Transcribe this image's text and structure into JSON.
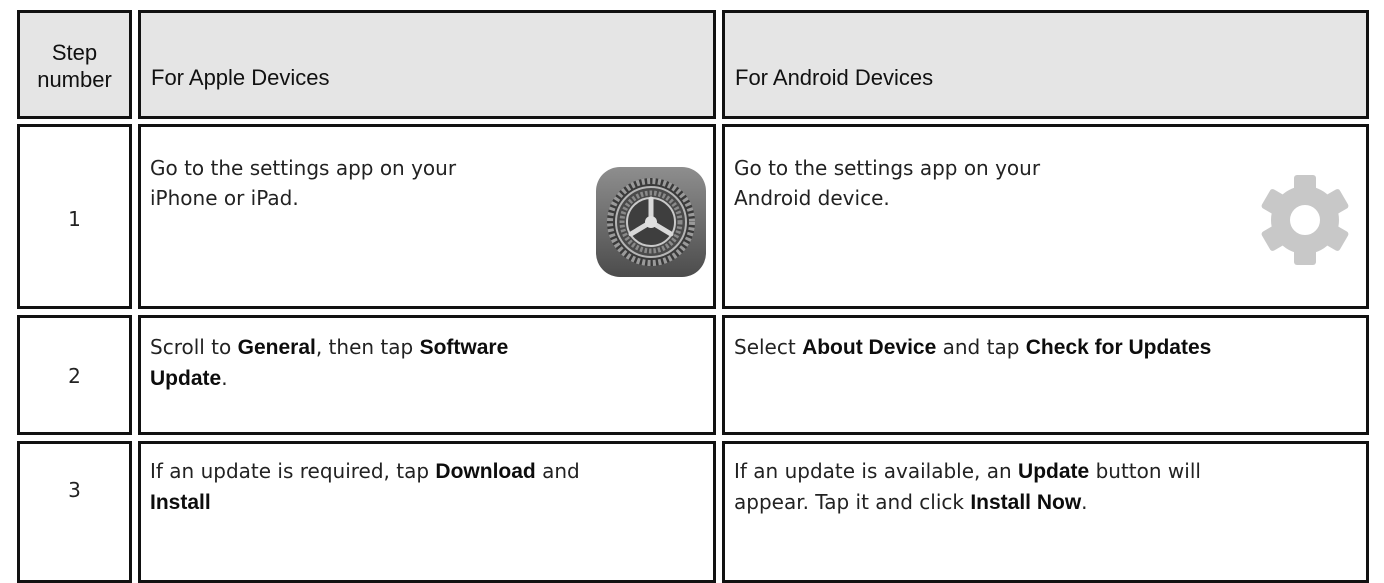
{
  "headers": {
    "step_line1": "Step",
    "step_line2": "number",
    "apple": "For Apple Devices",
    "android": "For Android Devices"
  },
  "rows": [
    {
      "number": "1",
      "apple": {
        "line1": "Go to the settings app on your",
        "line2": "iPhone or iPad.",
        "icon": "ios-settings-gear-icon"
      },
      "android": {
        "line1": "Go to the settings app on your",
        "line2": "Android device.",
        "icon": "android-settings-gear-icon"
      }
    },
    {
      "number": "2",
      "apple": {
        "t1": "Scroll to ",
        "b1": "General",
        "t2": ", then tap ",
        "b2": "Software",
        "b3": "Update",
        "t3": "."
      },
      "android": {
        "t1": "Select ",
        "b1": "About Device",
        "t2": " and tap ",
        "b2": "Check for Updates"
      }
    },
    {
      "number": "3",
      "apple": {
        "t1": "If an update is required, tap ",
        "b1": "Download",
        "t2": " and",
        "b2": "Install"
      },
      "android": {
        "t1": "If an update is available, an ",
        "b1": "Update",
        "t2": " button will",
        "t3": "appear. Tap it and click ",
        "b2": "Install Now",
        "t4": "."
      }
    }
  ],
  "colors": {
    "header_bg": "#e5e5e5",
    "border": "#111111",
    "ios_icon_bg": "#6f6f6f",
    "android_gear": "#c8c8c8"
  }
}
